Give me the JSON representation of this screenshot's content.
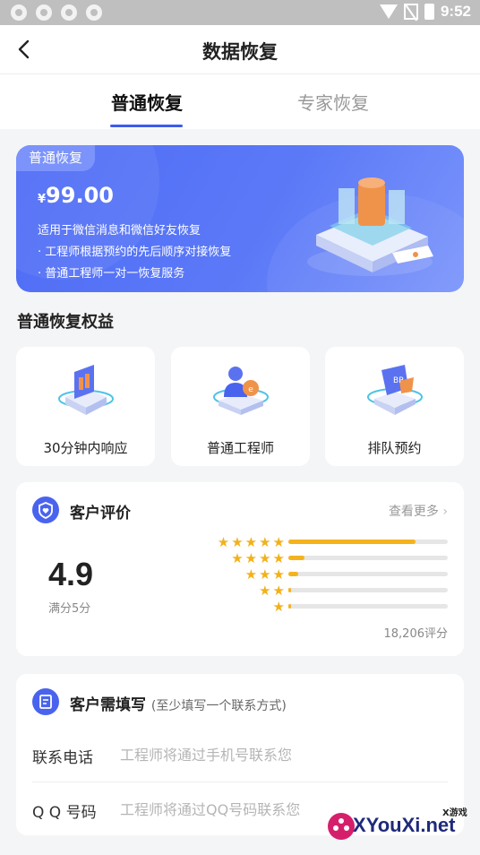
{
  "status_bar": {
    "time": "9:52"
  },
  "nav": {
    "title": "数据恢复"
  },
  "tabs": [
    {
      "label": "普通恢复",
      "active": true
    },
    {
      "label": "专家恢复",
      "active": false
    }
  ],
  "promo": {
    "badge": "普通恢复",
    "currency": "¥",
    "price": "99.00",
    "desc": [
      "适用于微信消息和微信好友恢复",
      "· 工程师根据预约的先后顺序对接恢复",
      "· 普通工程师一对一恢复服务"
    ]
  },
  "benefits": {
    "title": "普通恢复权益",
    "items": [
      {
        "label": "30分钟内响应",
        "icon": "clock-cube-icon"
      },
      {
        "label": "普通工程师",
        "icon": "engineer-icon"
      },
      {
        "label": "排队预约",
        "icon": "queue-badge-icon"
      }
    ]
  },
  "reviews": {
    "title": "客户评价",
    "more": "查看更多",
    "score": "4.9",
    "score_sub": "满分5分",
    "count": "18,206评分",
    "distribution": [
      {
        "stars": 5,
        "fraction": 0.8
      },
      {
        "stars": 4,
        "fraction": 0.1
      },
      {
        "stars": 3,
        "fraction": 0.06
      },
      {
        "stars": 2,
        "fraction": 0.015
      },
      {
        "stars": 1,
        "fraction": 0.01
      }
    ]
  },
  "form": {
    "title": "客户需填写",
    "note": "(至少填写一个联系方式)",
    "phone_label": "联系电话",
    "phone_placeholder": "工程师将通过手机号联系您",
    "qq_label": "Q Q 号码",
    "qq_placeholder": "工程师将通过QQ号码联系您"
  },
  "watermark": {
    "text": "XYouXi.net",
    "small": "X游戏"
  },
  "colors": {
    "accent": "#3d5af1",
    "star": "#f2b11b"
  }
}
